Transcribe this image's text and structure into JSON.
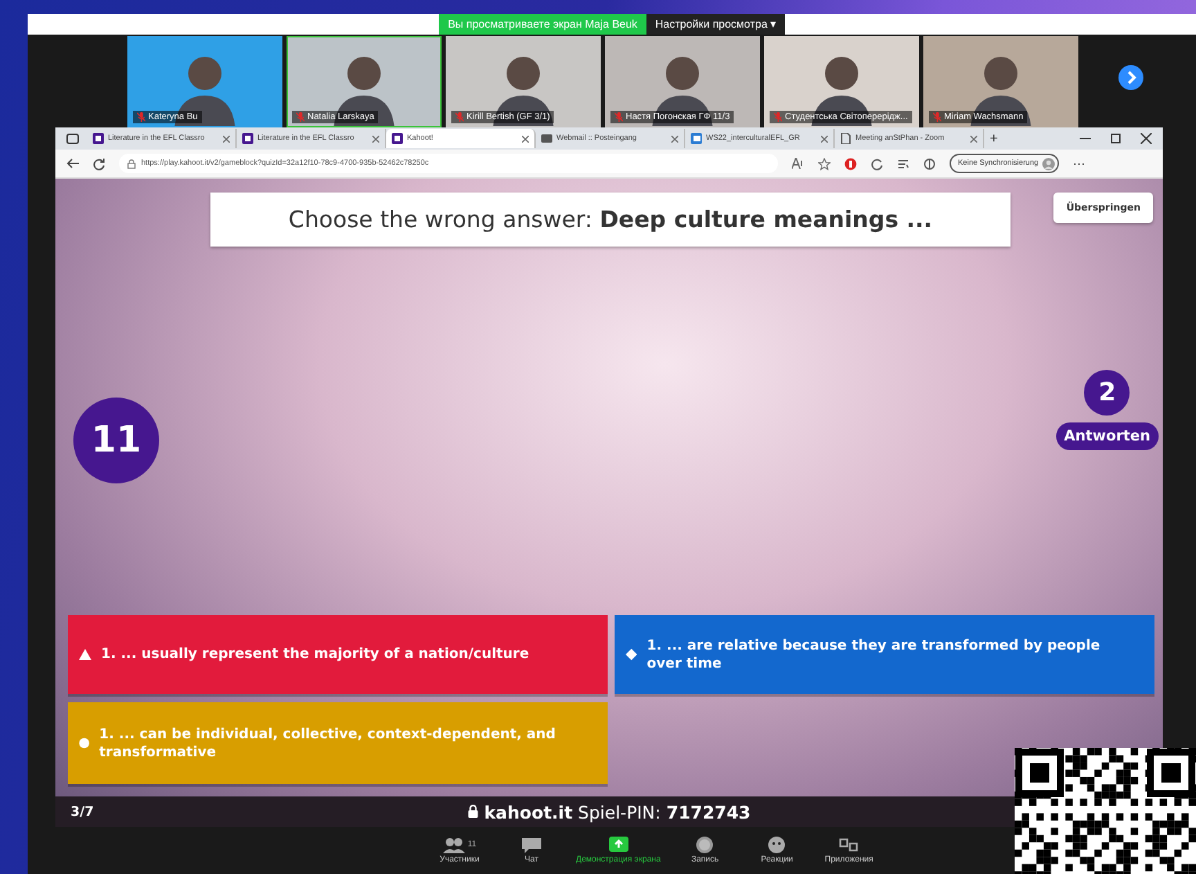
{
  "meeting_banner": {
    "viewing": "Вы просматриваете экран Maja Beuk",
    "view_options": "Настройки просмотра ▾"
  },
  "participants": [
    {
      "name": "Kateryna Bu",
      "muted": true,
      "speaking": false
    },
    {
      "name": "Natalia Larskaya",
      "muted": true,
      "speaking": true
    },
    {
      "name": "Kirill Bertish (GF 3/1)",
      "muted": true,
      "speaking": false
    },
    {
      "name": "Настя Погонская ГФ 11/3",
      "muted": true,
      "speaking": false
    },
    {
      "name": "Студентська Світоперерідж...",
      "muted": true,
      "speaking": false
    },
    {
      "name": "Miriam Wachsmann",
      "muted": true,
      "speaking": false
    }
  ],
  "browser": {
    "tabs": [
      {
        "label": "Literature in the EFL Classro",
        "kind": "kahoot",
        "selected": false
      },
      {
        "label": "Literature in the EFL Classro",
        "kind": "kahoot",
        "selected": false
      },
      {
        "label": "Kahoot!",
        "kind": "kahoot",
        "selected": true
      },
      {
        "label": "Webmail :: Posteingang",
        "kind": "mail",
        "selected": false
      },
      {
        "label": "WS22_interculturalEFL_GR",
        "kind": "doc",
        "selected": false
      },
      {
        "label": "Meeting anStPhan - Zoom",
        "kind": "page",
        "selected": false
      }
    ],
    "new_tab": "+",
    "url": "https://play.kahoot.it/v2/gameblock?quizId=32a12f10-78c9-4700-935b-52462c78250c",
    "profile": "Keine Synchronisierung",
    "more": "⋯"
  },
  "game": {
    "question": "Choose the wrong answer: **Deep culture meanings ...**",
    "skip": "Überspringen",
    "timer": "11",
    "answer_count": "2",
    "answer_label": "Antworten",
    "answers": [
      {
        "text": "1. ... usually represent the majority of a nation/culture",
        "kind": "triangle",
        "color": "#e21b3c"
      },
      {
        "text": "1. ... are relative because they are transformed by people over time",
        "kind": "diamond",
        "color": "#1368ce"
      },
      {
        "text": "1. ... can be individual, collective, context-dependent, and transformative",
        "kind": "circle",
        "color": "#d89e00"
      }
    ],
    "progress": "3/7",
    "site": "kahoot.it",
    "pin_label": "Spiel-PIN:",
    "pin": "7172743"
  },
  "toolbar": [
    {
      "label": "Участники",
      "kind": "participants",
      "count": "11"
    },
    {
      "label": "Чат",
      "kind": "chat"
    },
    {
      "label": "Демонстрация экрана",
      "kind": "share"
    },
    {
      "label": "Запись",
      "kind": "record"
    },
    {
      "label": "Реакции",
      "kind": "reactions"
    },
    {
      "label": "Приложения",
      "kind": "apps"
    }
  ]
}
